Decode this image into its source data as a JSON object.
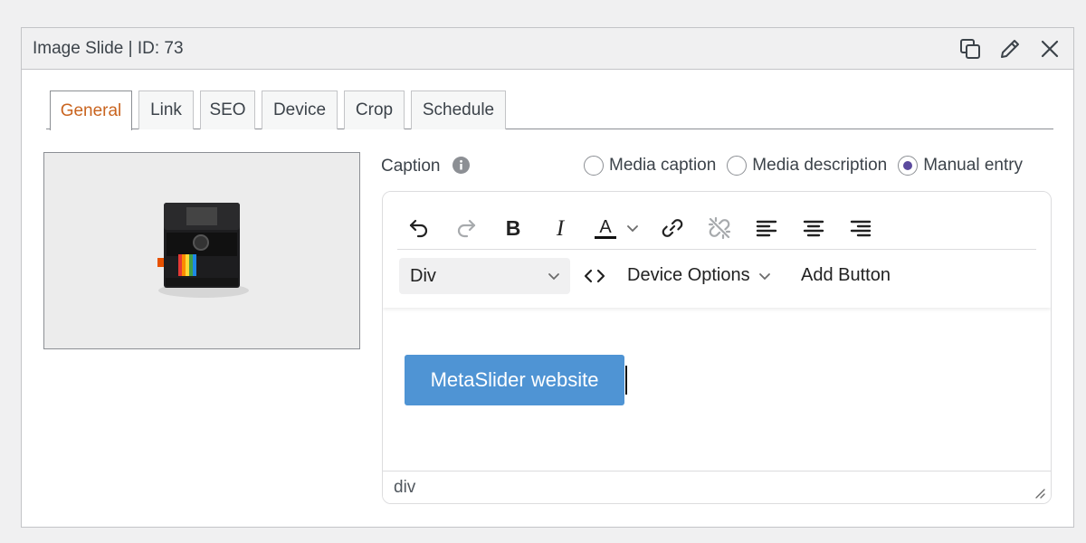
{
  "panel": {
    "title": "Image Slide | ID: 73"
  },
  "header_icons": [
    "duplicate-icon",
    "pencil-icon",
    "close-icon"
  ],
  "tabs": [
    {
      "label": "General",
      "active": true
    },
    {
      "label": "Link"
    },
    {
      "label": "SEO"
    },
    {
      "label": "Device"
    },
    {
      "label": "Crop"
    },
    {
      "label": "Schedule"
    }
  ],
  "caption": {
    "label": "Caption",
    "options": [
      {
        "label": "Media caption",
        "checked": false
      },
      {
        "label": "Media description",
        "checked": false
      },
      {
        "label": "Manual entry",
        "checked": true
      }
    ]
  },
  "editor": {
    "toolbar_icons": [
      "undo-icon",
      "redo-icon",
      "bold-icon",
      "italic-icon",
      "text-color-icon",
      "chevron-down-icon",
      "link-icon",
      "unlink-icon",
      "align-left-icon",
      "align-center-icon",
      "align-right-icon"
    ],
    "format_value": "Div",
    "device_options_label": "Device Options",
    "add_button_label": "Add Button",
    "content_button_label": "MetaSlider website",
    "status_path": "div"
  },
  "colors": {
    "active_tab": "#c9641f",
    "accent_button": "#4f94d4",
    "radio_checked": "#5b4a9e"
  }
}
